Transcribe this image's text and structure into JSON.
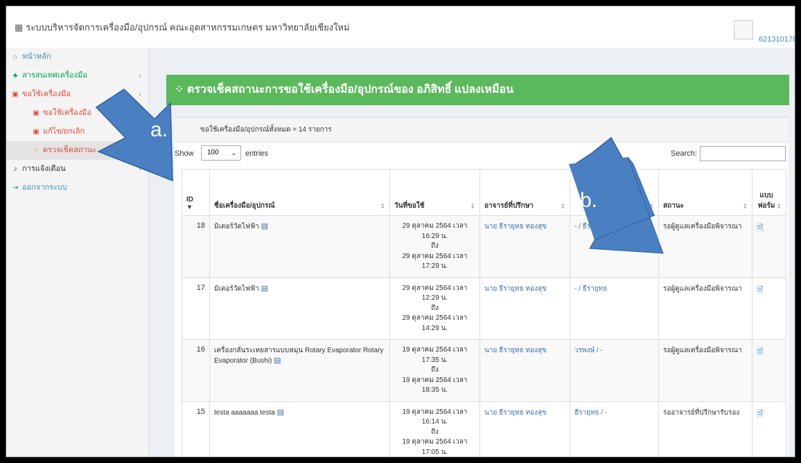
{
  "header": {
    "title_icon": "grid-icon",
    "title": "ระบบบริหารจัดการเครื่องมือ/อุปกรณ์ คณะอุตสาหกรรมเกษตร มหาวิทยาลัยเชียงใหม่",
    "username": "621310178"
  },
  "sidebar": {
    "items": [
      {
        "icon": "home-icon",
        "label": "หน้าหลัก"
      },
      {
        "icon": "users-icon",
        "label": "สารสนเทศเครื่องมือ"
      },
      {
        "icon": "calendar-icon",
        "label": "ขอใช้เครื่องมือ"
      },
      {
        "icon": "calendar-icon",
        "label": "ขอใช้เครื่องมือ"
      },
      {
        "icon": "calendar-icon",
        "label": "แก้ไข/ยกเลิก"
      },
      {
        "icon": "spinner-icon",
        "label": "ตรวจเช็คสถานะ"
      },
      {
        "icon": "bell-icon",
        "label": "การแจ้งเตือน"
      },
      {
        "icon": "logout-icon",
        "label": "ออกจากระบบ"
      }
    ]
  },
  "main": {
    "banner_title": "ตรวจเช็คสถานะการขอใช้เครื่องมือ/อุปกรณ์ของ อภิสิทธิ์ แปลงเหมือน",
    "count_text": "ขอใช้เครื่องมือ/อุปกรณ์ทั้งหมด = 14 รายการ",
    "show_label": "Show",
    "entries_value": "100",
    "entries_label": "entries",
    "search_label": "Search:",
    "search_value": ""
  },
  "table": {
    "headers": [
      "ID",
      "ชื่อเครื่องมือ/อุปกรณ์",
      "วันที่ขอใช้",
      "อาจารย์ที่ปรึกษา",
      "",
      "สถานะ",
      "แบบฟอร์ม"
    ],
    "rows": [
      {
        "id": "18",
        "name": "มิเตอร์วัดไฟฟ้า",
        "date_start": "29 ตุลาคม 2564 เวลา 16:29 น.",
        "to": "ถึง",
        "date_end": "29 ตุลาคม 2564 เวลา 17:29 น.",
        "teacher": "นาย ธีรายุทธ ทองสุข",
        "approver": "- / ธีรายุทธ",
        "status": "รอผู้ดูแลเครื่องมือพิจารณา"
      },
      {
        "id": "17",
        "name": "มิเตอร์วัดไฟฟ้า",
        "date_start": "29 ตุลาคม 2564 เวลา 12:29 น.",
        "to": "ถึง",
        "date_end": "29 ตุลาคม 2564 เวลา 14:29 น.",
        "teacher": "นาย ธีรายุทธ ทองสุข",
        "approver": "- / ธีรายุทธ",
        "status": "รอผู้ดูแลเครื่องมือพิจารณา"
      },
      {
        "id": "16",
        "name": "เครื่องกลั่นระเหยสารแบบหมุน Rotary Evaporator  Rotary Evaporator (Bushi)",
        "date_start": "19 ตุลาคม 2564 เวลา 17:35 น.",
        "to": "ถึง",
        "date_end": "19 ตุลาคม 2564 เวลา 18:35 น.",
        "teacher": "นาย ธีรายุทธ ทองสุข",
        "approver": "วรพงษ์ / -",
        "status": "รอผู้ดูแลเครื่องมือพิจารณา"
      },
      {
        "id": "15",
        "name": "testa aaaaaaa testa",
        "date_start": "19 ตุลาคม 2564 เวลา 16:14 น.",
        "to": "ถึง",
        "date_end": "19 ตุลาคม 2564 เวลา 17:05 น.",
        "teacher": "นาย ธีรายุทธ ทองสุข",
        "approver": "ธีรายุทธ / -",
        "status": "รออาจารย์ที่ปรึกษารับรอง"
      }
    ]
  },
  "annotations": {
    "arrow_a_label": "a.",
    "arrow_b_label": "b."
  },
  "colors": {
    "arrow_fill": "#4a7fc1",
    "banner_green": "#5cb85c"
  }
}
